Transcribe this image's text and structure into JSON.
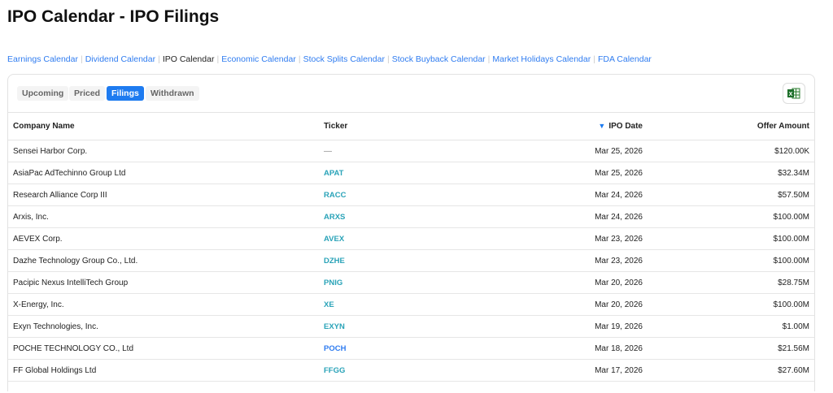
{
  "title": "IPO Calendar - IPO Filings",
  "nav": [
    "Earnings Calendar",
    "Dividend Calendar",
    "IPO Calendar",
    "Economic Calendar",
    "Stock Splits Calendar",
    "Stock Buyback Calendar",
    "Market Holidays Calendar",
    "FDA Calendar"
  ],
  "nav_active": "IPO Calendar",
  "tabs": [
    "Upcoming",
    "Priced",
    "Filings",
    "Withdrawn"
  ],
  "active_tab": "Filings",
  "export_icon": "excel-icon",
  "columns": [
    "Company Name",
    "Ticker",
    "IPO Date",
    "Offer Amount"
  ],
  "sort": {
    "column": "IPO Date",
    "direction": "desc",
    "icon": "▼"
  },
  "rows": [
    {
      "company": "Sensei Harbor Corp.",
      "ticker": "—",
      "date": "Mar 25, 2026",
      "amount": "$120.00K"
    },
    {
      "company": "AsiaPac AdTechinno Group Ltd",
      "ticker": "APAT",
      "date": "Mar 25, 2026",
      "amount": "$32.34M"
    },
    {
      "company": "Research Alliance Corp III",
      "ticker": "RACC",
      "date": "Mar 24, 2026",
      "amount": "$57.50M"
    },
    {
      "company": "Arxis, Inc.",
      "ticker": "ARXS",
      "date": "Mar 24, 2026",
      "amount": "$100.00M"
    },
    {
      "company": "AEVEX Corp.",
      "ticker": "AVEX",
      "date": "Mar 23, 2026",
      "amount": "$100.00M"
    },
    {
      "company": "Dazhe Technology Group Co., Ltd.",
      "ticker": "DZHE",
      "date": "Mar 23, 2026",
      "amount": "$100.00M"
    },
    {
      "company": "Pacipic Nexus IntelliTech Group",
      "ticker": "PNIG",
      "date": "Mar 20, 2026",
      "amount": "$28.75M"
    },
    {
      "company": "X-Energy, Inc.",
      "ticker": "XE",
      "date": "Mar 20, 2026",
      "amount": "$100.00M"
    },
    {
      "company": "Exyn Technologies, Inc.",
      "ticker": "EXYN",
      "date": "Mar 19, 2026",
      "amount": "$1.00M"
    },
    {
      "company": "POCHE TECHNOLOGY CO., Ltd",
      "ticker": "POCH",
      "date": "Mar 18, 2026",
      "amount": "$21.56M"
    },
    {
      "company": "FF Global Holdings Ltd",
      "ticker": "FFGG",
      "date": "Mar 17, 2026",
      "amount": "$27.60M"
    }
  ],
  "colors": {
    "link": "#2f7cf0",
    "ticker": "#2aa3b8",
    "active_tab": "#1e7bf0"
  }
}
